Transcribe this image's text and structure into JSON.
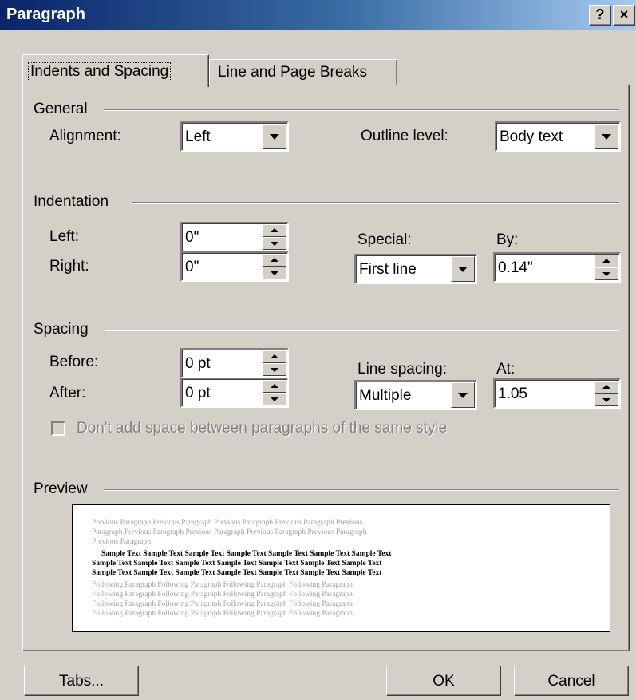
{
  "window": {
    "title": "Paragraph",
    "help_label": "?",
    "close_label": "×"
  },
  "tabs": [
    {
      "label": "Indents and Spacing",
      "active": true
    },
    {
      "label": "Line and Page Breaks",
      "active": false
    }
  ],
  "general": {
    "heading": "General",
    "alignment_label": "Alignment:",
    "alignment_value": "Left",
    "outline_label": "Outline level:",
    "outline_value": "Body text"
  },
  "indentation": {
    "heading": "Indentation",
    "left_label": "Left:",
    "left_value": "0\"",
    "right_label": "Right:",
    "right_value": "0\"",
    "special_label": "Special:",
    "special_value": "First line",
    "by_label": "By:",
    "by_value": "0.14\""
  },
  "spacing": {
    "heading": "Spacing",
    "before_label": "Before:",
    "before_value": "0 pt",
    "after_label": "After:",
    "after_value": "0 pt",
    "line_spacing_label": "Line spacing:",
    "line_spacing_value": "Multiple",
    "at_label": "At:",
    "at_value": "1.05",
    "dont_add_label": "Don't add space between paragraphs of the same style"
  },
  "preview": {
    "heading": "Preview",
    "prev_lines": [
      "Previous Paragraph Previous Paragraph Previous Paragraph Previous Paragraph Previous",
      "Paragraph Previous Paragraph Previous Paragraph Previous Paragraph Previous Paragraph",
      "Previous Paragraph"
    ],
    "sample_lines": [
      "Sample Text Sample Text Sample Text Sample Text Sample Text Sample Text Sample Text",
      "Sample Text Sample Text Sample Text Sample Text Sample Text Sample Text Sample Text",
      "Sample Text Sample Text Sample Text Sample Text Sample Text Sample Text Sample Text"
    ],
    "following_lines": [
      "Following Paragraph Following Paragraph Following Paragraph Following Paragraph",
      "Following Paragraph Following Paragraph Following Paragraph Following Paragraph",
      "Following Paragraph Following Paragraph Following Paragraph Following Paragraph",
      "Following Paragraph Following Paragraph Following Paragraph Following Paragraph"
    ]
  },
  "buttons": {
    "tabs_label": "Tabs...",
    "ok_label": "OK",
    "cancel_label": "Cancel"
  }
}
